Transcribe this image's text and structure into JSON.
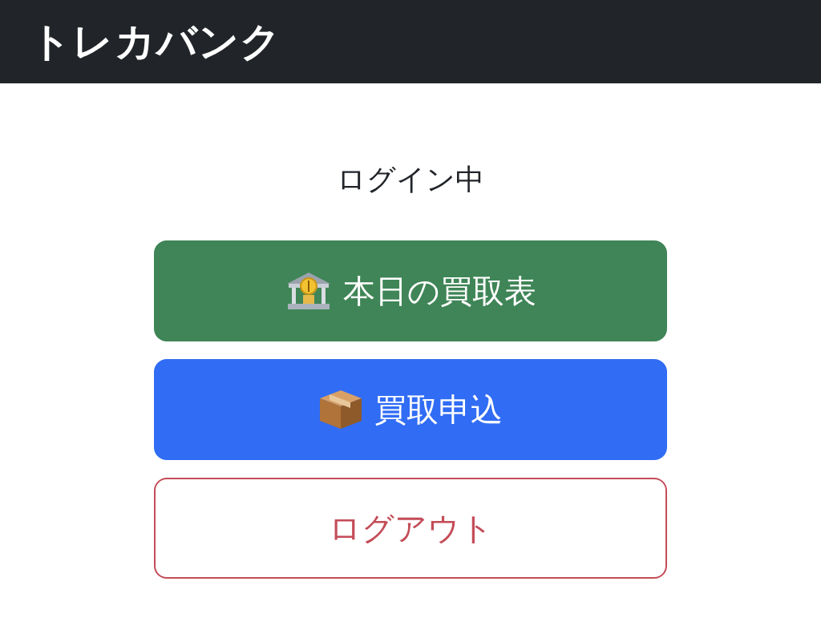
{
  "navbar": {
    "brand": "トレカバンク"
  },
  "status": "ログイン中",
  "buttons": [
    {
      "label": "本日の買取表",
      "kind": "success"
    },
    {
      "label": "買取申込",
      "kind": "primary"
    },
    {
      "label": "ログアウト",
      "kind": "outline-danger"
    }
  ]
}
